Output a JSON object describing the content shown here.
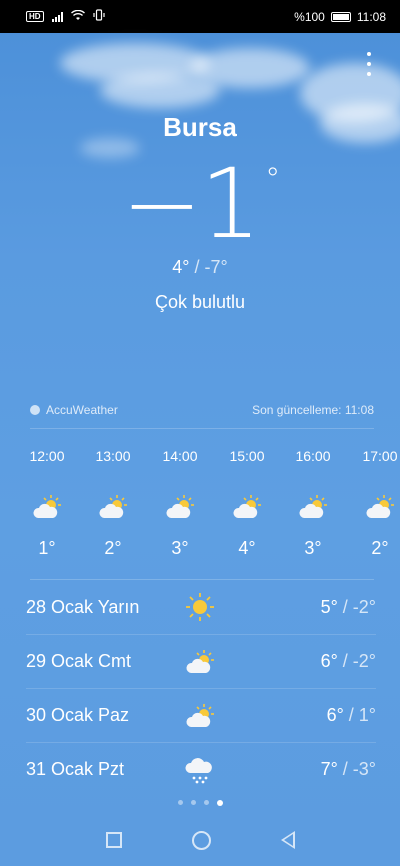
{
  "status": {
    "battery": "%100",
    "time": "11:08",
    "hd": "HD"
  },
  "location": {
    "city": "Bursa"
  },
  "current": {
    "temp": "−1",
    "deg": "°",
    "high": "4°",
    "low": " / -7°",
    "condition": "Çok bulutlu"
  },
  "meta": {
    "provider": "AccuWeather",
    "updated": "Son güncelleme: 11:08"
  },
  "hourly": [
    {
      "time": "12:00",
      "temp": "1°",
      "icon": "partly-cloudy-icon"
    },
    {
      "time": "13:00",
      "temp": "2°",
      "icon": "partly-cloudy-icon"
    },
    {
      "time": "14:00",
      "temp": "3°",
      "icon": "partly-cloudy-icon"
    },
    {
      "time": "15:00",
      "temp": "4°",
      "icon": "partly-cloudy-icon"
    },
    {
      "time": "16:00",
      "temp": "3°",
      "icon": "partly-cloudy-icon"
    },
    {
      "time": "17:00",
      "temp": "2°",
      "icon": "partly-cloudy-icon"
    }
  ],
  "daily": [
    {
      "day": "28 Ocak Yarın",
      "high": "5°",
      "low": " / -2°",
      "icon": "sunny-icon"
    },
    {
      "day": "29 Ocak Cmt",
      "high": "6°",
      "low": " / -2°",
      "icon": "partly-cloudy-icon"
    },
    {
      "day": "30 Ocak Paz",
      "high": "6°",
      "low": " / 1°",
      "icon": "partly-cloudy-icon"
    },
    {
      "day": "31 Ocak Pzt",
      "high": "7°",
      "low": " / -3°",
      "icon": "snow-icon"
    }
  ],
  "pager": {
    "count": 4,
    "active": 3
  },
  "colors": {
    "sky": "#5c9ce0",
    "sun": "#f8c93a"
  }
}
